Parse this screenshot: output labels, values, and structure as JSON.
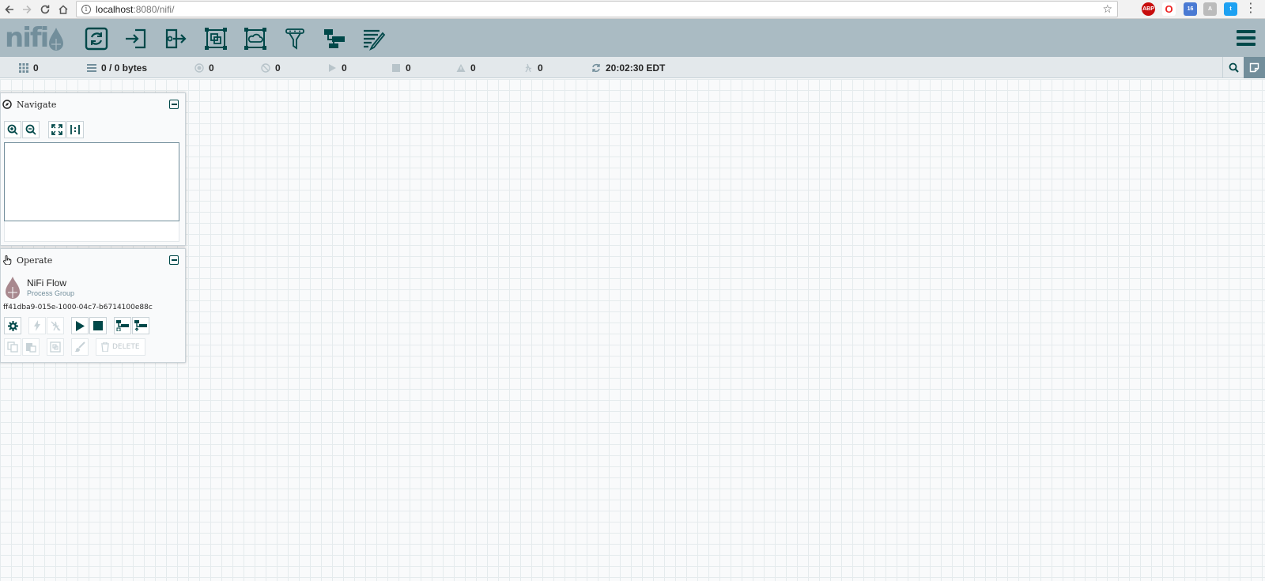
{
  "browser": {
    "url_host": "localhost",
    "url_path": ":8080/nifi/"
  },
  "header": {
    "logo_text": "nifi",
    "tools": [
      "processor",
      "input-port",
      "output-port",
      "process-group",
      "remote-process-group",
      "funnel",
      "template",
      "label"
    ]
  },
  "status": {
    "active_threads": "0",
    "queued": "0 / 0 bytes",
    "transmitting": "0",
    "not_transmitting": "0",
    "running": "0",
    "stopped": "0",
    "invalid": "0",
    "disabled": "0",
    "last_refreshed": "20:02:30 EDT"
  },
  "navigate": {
    "title": "Navigate"
  },
  "operate": {
    "title": "Operate",
    "component_name": "NiFi Flow",
    "component_type": "Process Group",
    "component_id": "ff41dba9-015e-1000-04c7-b6714100e88c",
    "delete_label": "DELETE"
  },
  "colors": {
    "header_bg": "#aabbc3",
    "status_bg": "#e3e8eb",
    "primary": "#004849",
    "accent": "#728e9b"
  }
}
